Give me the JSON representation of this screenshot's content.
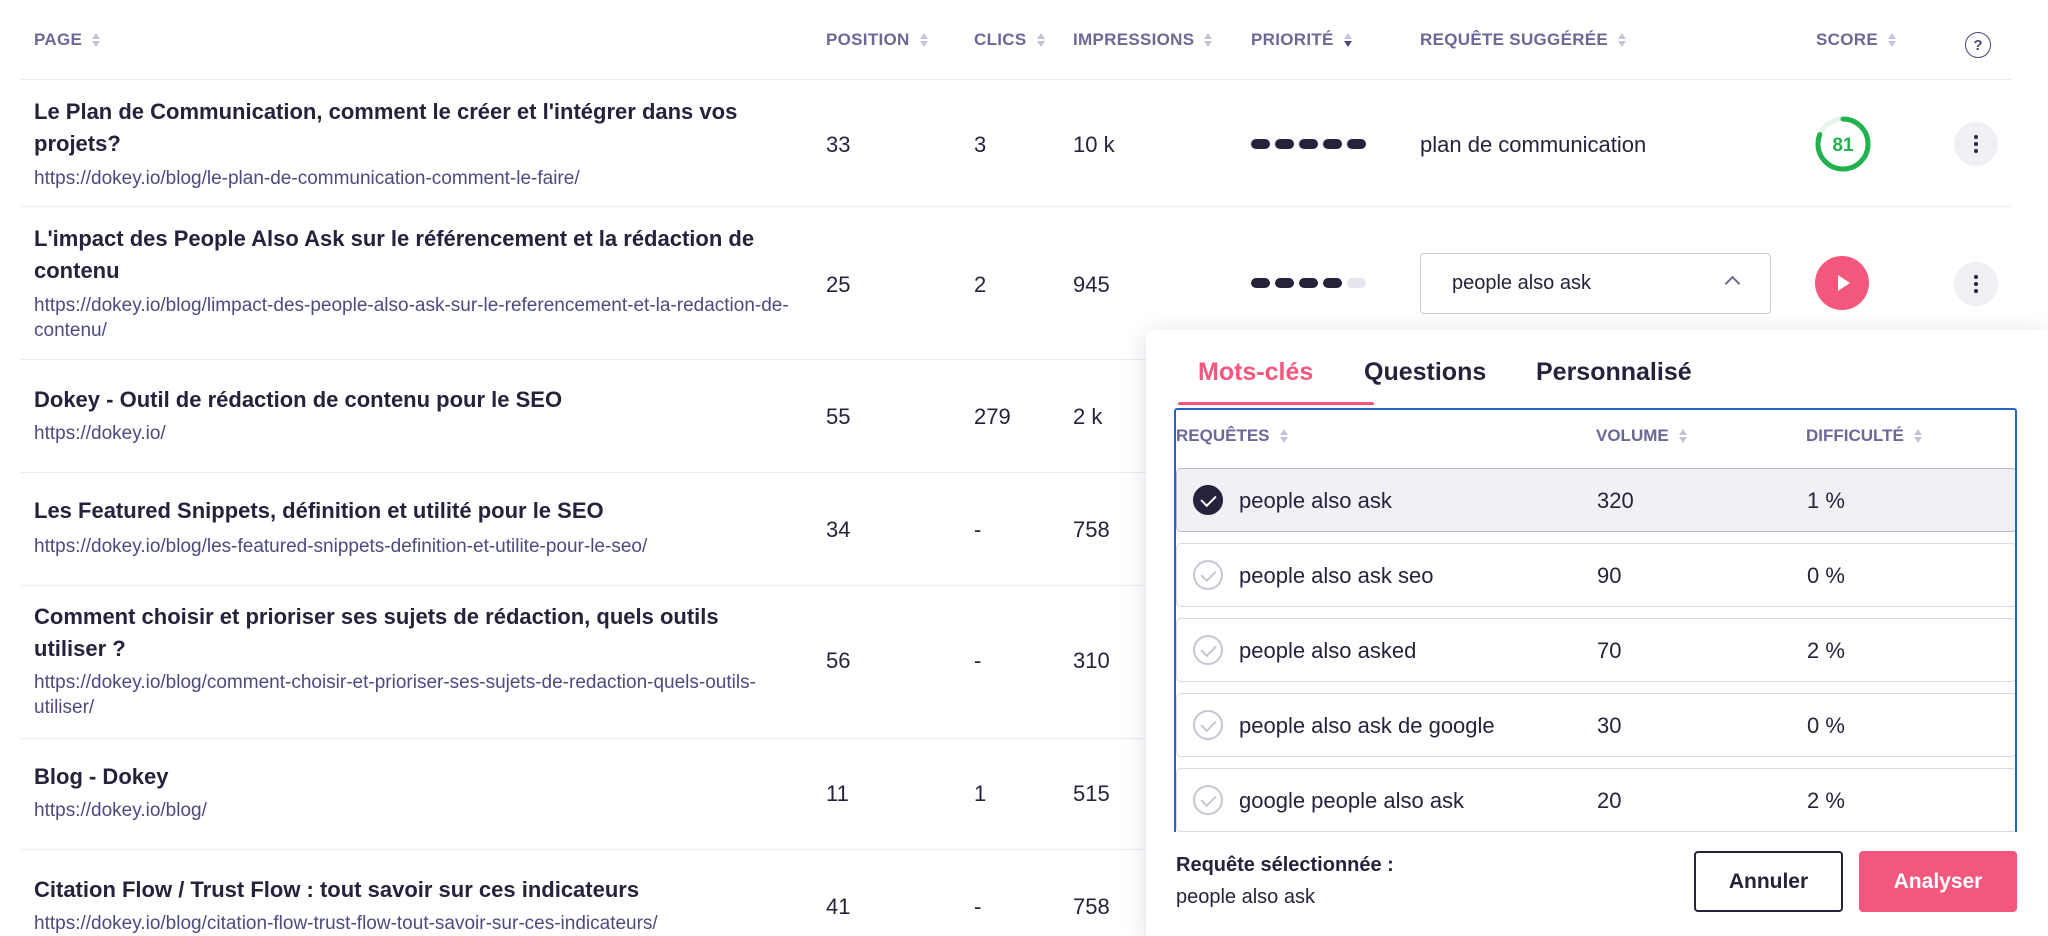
{
  "table": {
    "headers": {
      "page": "PAGE",
      "position": "POSITION",
      "clics": "CLICS",
      "impressions": "IMPRESSIONS",
      "priorite": "PRIORITÉ",
      "requete": "REQUÊTE SUGGÉRÉE",
      "score": "SCORE",
      "help": "?"
    },
    "rows": [
      {
        "title": "Le Plan de Communication, comment le créer et l'intégrer dans vos projets?",
        "url": "https://dokey.io/blog/le-plan-de-communication-comment-le-faire/",
        "position": "33",
        "clics": "3",
        "impressions": "10 k",
        "priority": 5,
        "query": "plan de communication",
        "score": "81",
        "score_percent": 81
      },
      {
        "title": "L'impact des People Also Ask sur le référencement et la rédaction de contenu",
        "url": "https://dokey.io/blog/limpact-des-people-also-ask-sur-le-referencement-et-la-redaction-de-contenu/",
        "position": "25",
        "clics": "2",
        "impressions": "945",
        "priority": 4,
        "query": "people also ask"
      },
      {
        "title": "Dokey - Outil de rédaction de contenu pour le SEO",
        "url": "https://dokey.io/",
        "position": "55",
        "clics": "279",
        "impressions": "2 k"
      },
      {
        "title": "Les Featured Snippets, définition et utilité pour le SEO",
        "url": "https://dokey.io/blog/les-featured-snippets-definition-et-utilite-pour-le-seo/",
        "position": "34",
        "clics": "-",
        "impressions": "758"
      },
      {
        "title": "Comment choisir et prioriser ses sujets de rédaction, quels outils utiliser ?",
        "url": "https://dokey.io/blog/comment-choisir-et-prioriser-ses-sujets-de-redaction-quels-outils-utiliser/",
        "position": "56",
        "clics": "-",
        "impressions": "310"
      },
      {
        "title": "Blog - Dokey",
        "url": "https://dokey.io/blog/",
        "position": "11",
        "clics": "1",
        "impressions": "515"
      },
      {
        "title": "Citation Flow / Trust Flow : tout savoir sur ces indicateurs",
        "url": "https://dokey.io/blog/citation-flow-trust-flow-tout-savoir-sur-ces-indicateurs/",
        "position": "41",
        "clics": "-",
        "impressions": "758"
      }
    ]
  },
  "popover": {
    "tabs": [
      "Mots-clés",
      "Questions",
      "Personnalisé"
    ],
    "active_tab": "Mots-clés",
    "columns": {
      "requetes": "REQUÊTES",
      "volume": "VOLUME",
      "difficulte": "DIFFICULTÉ"
    },
    "keywords": [
      {
        "query": "people also ask",
        "volume": "320",
        "difficulty": "1 %",
        "selected": true
      },
      {
        "query": "people also ask seo",
        "volume": "90",
        "difficulty": "0 %",
        "selected": false
      },
      {
        "query": "people also asked",
        "volume": "70",
        "difficulty": "2 %",
        "selected": false
      },
      {
        "query": "people also ask de google",
        "volume": "30",
        "difficulty": "0 %",
        "selected": false
      },
      {
        "query": "google people also ask",
        "volume": "20",
        "difficulty": "2 %",
        "selected": false
      }
    ],
    "selected_label": "Requête sélectionnée :",
    "selected_value": "people also ask",
    "cancel_label": "Annuler",
    "analyse_label": "Analyser"
  },
  "colors": {
    "accent": "#f4577d",
    "score_green": "#22b14c",
    "text_dark": "#24233b",
    "header_purple": "#6b6896",
    "link_purple": "#4d4a80",
    "panel_border": "#2663c5"
  }
}
